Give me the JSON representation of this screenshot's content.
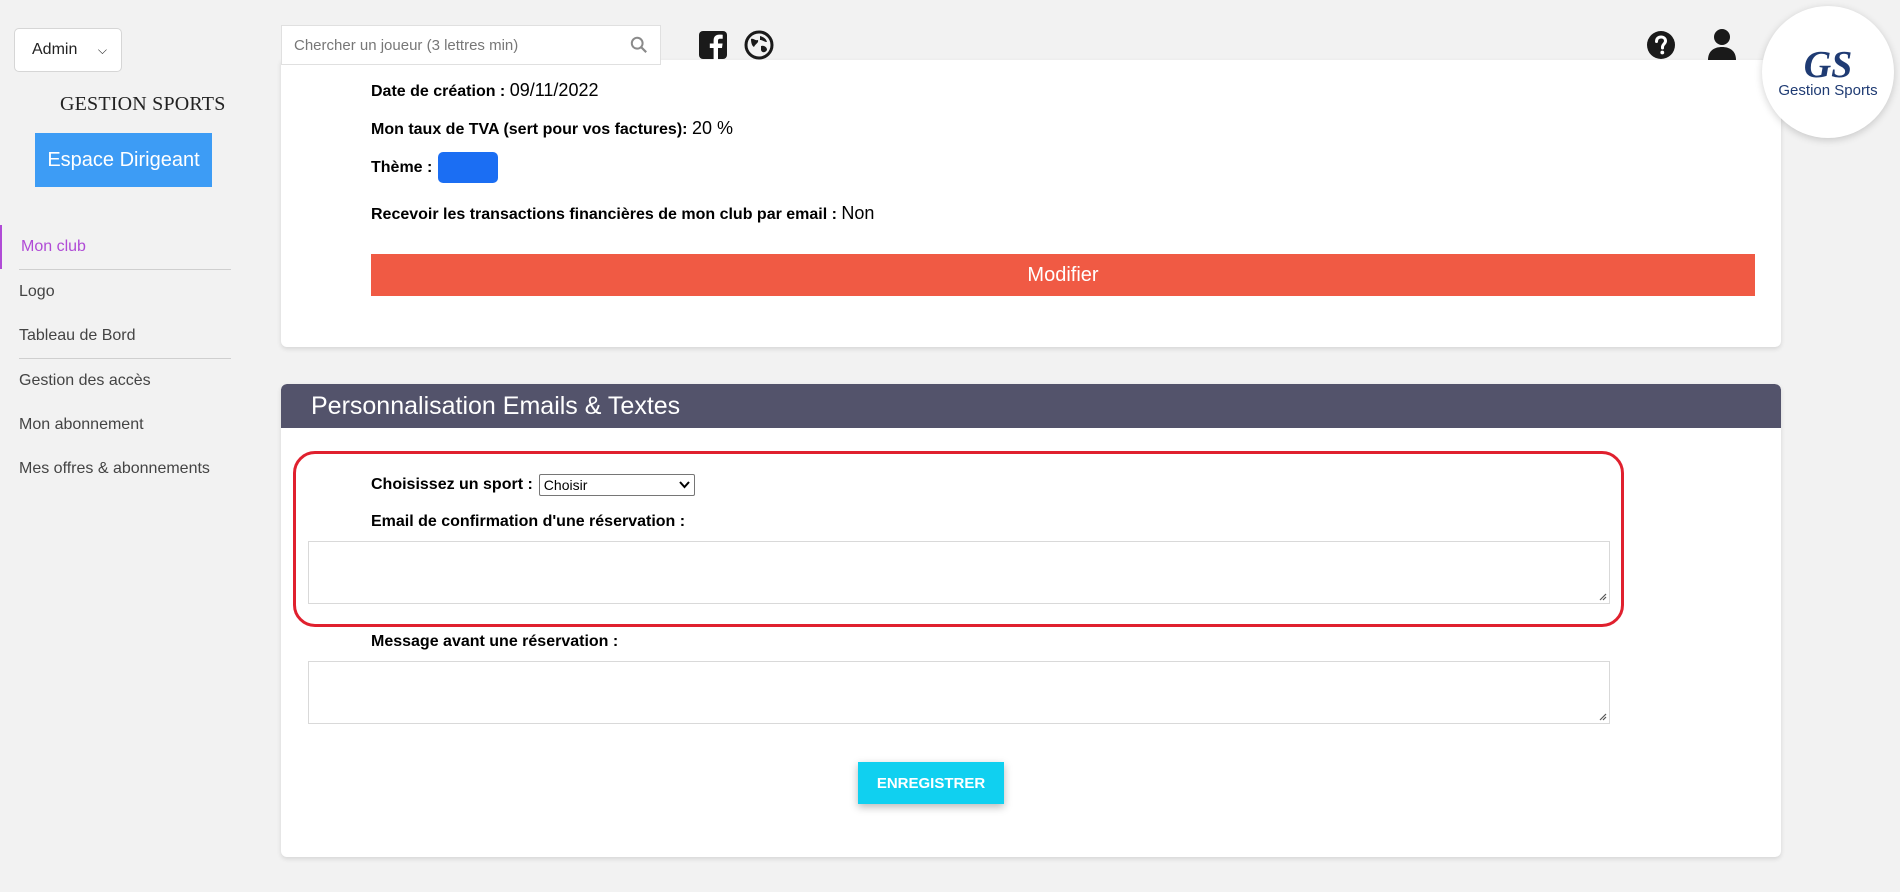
{
  "sidebar": {
    "role_select": "Admin",
    "brand": "GESTION SPORTS",
    "espace_button": "Espace Dirigeant",
    "items": [
      {
        "label": "Mon club"
      },
      {
        "label": "Logo"
      },
      {
        "label": "Tableau de Bord"
      },
      {
        "label": "Gestion des accès"
      },
      {
        "label": "Mon abonnement"
      },
      {
        "label": "Mes offres & abonnements"
      }
    ]
  },
  "topbar": {
    "search_placeholder": "Chercher un joueur (3 lettres min)",
    "logo_monogram": "GS",
    "logo_text": "Gestion Sports"
  },
  "club_card": {
    "date_label": "Date de création :",
    "date_value": "09/11/2022",
    "tva_label": "Mon taux de TVA (sert pour vos factures):",
    "tva_value": "20 %",
    "theme_label": "Thème :",
    "theme_color": "#1b6ef3",
    "mail_label": "Recevoir les transactions financières de mon club par email :",
    "mail_value": "Non",
    "modify_button": "Modifier"
  },
  "perso_card": {
    "title": "Personnalisation Emails & Textes",
    "sport_label": "Choisissez un sport :",
    "sport_selected": "Choisir",
    "email_label": "Email de confirmation d'une réservation :",
    "email_value": "",
    "message_label": "Message avant une réservation :",
    "message_value": "",
    "save_button": "ENREGISTRER"
  },
  "colors": {
    "accent_active": "#b04bd6",
    "espace_button": "#3d9cf5",
    "modify_button": "#f05a44",
    "save_button": "#10d0f0",
    "header": "#53536b",
    "highlight": "#e0202e"
  }
}
